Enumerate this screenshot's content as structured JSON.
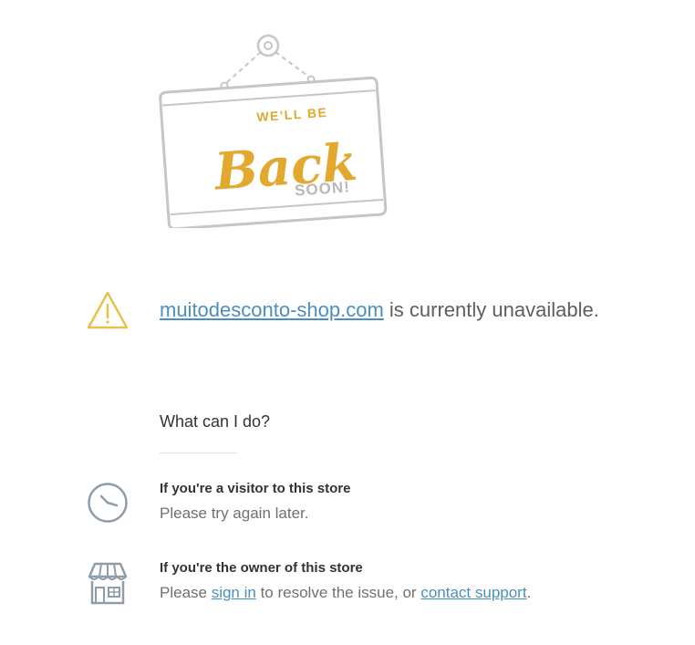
{
  "sign": {
    "line1": "WE'LL BE",
    "line2": "Back",
    "line3": "SOON!"
  },
  "headline": {
    "domain": "muitodesconto-shop.com",
    "rest": " is currently unavailable."
  },
  "what_heading": "What can I do?",
  "visitor": {
    "title": "If you're a visitor to this store",
    "text": "Please try again later."
  },
  "owner": {
    "title": "If you're the owner of this store",
    "text_before": "Please ",
    "sign_in": "sign in",
    "text_middle": " to resolve the issue, or ",
    "contact": "contact support",
    "text_after": "."
  },
  "colors": {
    "link": "#4a8fbd",
    "sign_gold": "#e2a92e",
    "warning": "#e7c24a",
    "icon_gray": "#8f9daa"
  }
}
